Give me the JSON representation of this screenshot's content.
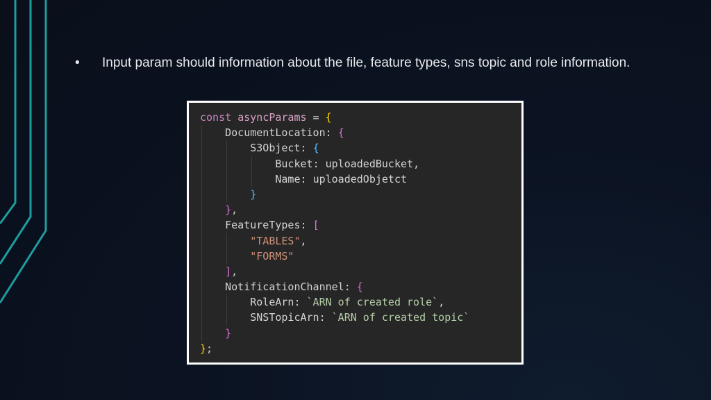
{
  "slide": {
    "bullet_symbol": "•",
    "bullet_text": "Input param should information about the file, feature types, sns topic and role information."
  },
  "code": {
    "lines": [
      {
        "indent": 0,
        "tokens": [
          [
            "kw",
            "const "
          ],
          [
            "vn2",
            "asyncParams"
          ],
          [
            "pn",
            " = "
          ],
          [
            "br1",
            "{"
          ]
        ]
      },
      {
        "indent": 1,
        "tokens": [
          [
            "prop",
            "DocumentLocation"
          ],
          [
            "pn",
            ": "
          ],
          [
            "br2",
            "{"
          ]
        ]
      },
      {
        "indent": 2,
        "tokens": [
          [
            "prop",
            "S3Object"
          ],
          [
            "pn",
            ": "
          ],
          [
            "br3",
            "{"
          ]
        ]
      },
      {
        "indent": 3,
        "tokens": [
          [
            "prop",
            "Bucket"
          ],
          [
            "pn",
            ": "
          ],
          [
            "id",
            "uploadedBucket"
          ],
          [
            "pn",
            ","
          ]
        ]
      },
      {
        "indent": 3,
        "tokens": [
          [
            "prop",
            "Name"
          ],
          [
            "pn",
            ": "
          ],
          [
            "id",
            "uploadedObjetct"
          ]
        ]
      },
      {
        "indent": 2,
        "tokens": [
          [
            "br3",
            "}"
          ]
        ]
      },
      {
        "indent": 1,
        "tokens": [
          [
            "br2",
            "}"
          ],
          [
            "pn",
            ","
          ]
        ]
      },
      {
        "indent": 1,
        "tokens": [
          [
            "prop",
            "FeatureTypes"
          ],
          [
            "pn",
            ": "
          ],
          [
            "br2",
            "["
          ]
        ]
      },
      {
        "indent": 2,
        "tokens": [
          [
            "str",
            "\"TABLES\""
          ],
          [
            "pn",
            ","
          ]
        ]
      },
      {
        "indent": 2,
        "tokens": [
          [
            "str",
            "\"FORMS\""
          ]
        ]
      },
      {
        "indent": 1,
        "tokens": [
          [
            "br2",
            "]"
          ],
          [
            "pn",
            ","
          ]
        ]
      },
      {
        "indent": 1,
        "tokens": [
          [
            "prop",
            "NotificationChannel"
          ],
          [
            "pn",
            ": "
          ],
          [
            "br2",
            "{"
          ]
        ]
      },
      {
        "indent": 2,
        "tokens": [
          [
            "prop",
            "RoleArn"
          ],
          [
            "pn",
            ": "
          ],
          [
            "tpl",
            "`ARN of created role`"
          ],
          [
            "pn",
            ","
          ]
        ]
      },
      {
        "indent": 2,
        "tokens": [
          [
            "prop",
            "SNSTopicArn"
          ],
          [
            "pn",
            ": "
          ],
          [
            "tpl",
            "`ARN of created topic`"
          ]
        ]
      },
      {
        "indent": 1,
        "tokens": [
          [
            "br2",
            "}"
          ]
        ]
      },
      {
        "indent": 0,
        "tokens": [
          [
            "br1",
            "}"
          ],
          [
            "pn",
            ";"
          ]
        ]
      }
    ]
  },
  "colors": {
    "background": "#0a0f1a",
    "accent_lines": "#1fa5a5",
    "code_background": "#262626",
    "frame": "#ffffff"
  }
}
